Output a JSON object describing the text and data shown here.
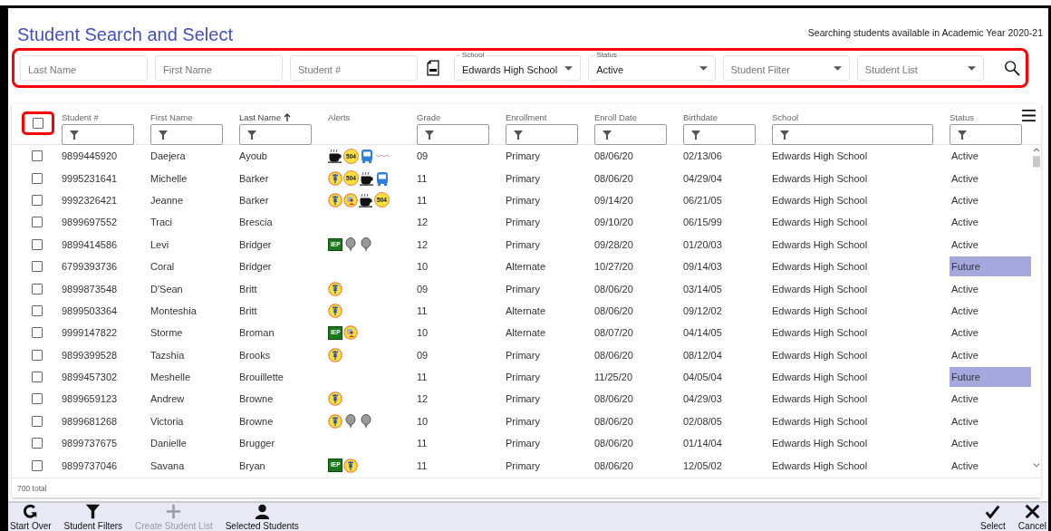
{
  "title": "Student Search and Select",
  "academic_year_note": "Searching students available in Academic Year 2020-21",
  "search_fields": [
    {
      "kind": "text",
      "placeholder": "Last Name"
    },
    {
      "kind": "text",
      "placeholder": "First Name"
    },
    {
      "kind": "text",
      "placeholder": "Student #"
    },
    {
      "kind": "csv"
    },
    {
      "kind": "select",
      "label": "School",
      "value": "Edwards High School"
    },
    {
      "kind": "select",
      "label": "Status",
      "value": "Active"
    },
    {
      "kind": "select",
      "placeholder": "Student Filter"
    },
    {
      "kind": "select",
      "placeholder": "Student List"
    },
    {
      "kind": "search"
    }
  ],
  "table": {
    "select_all": {
      "checked": false
    },
    "columns": [
      {
        "label": "Student #",
        "filter": true,
        "sorted": false
      },
      {
        "label": "First Name",
        "filter": true,
        "sorted": false
      },
      {
        "label": "Last Name",
        "filter": true,
        "sorted": true
      },
      {
        "label": "Alerts",
        "filter": false,
        "sorted": false
      },
      {
        "label": "Grade",
        "filter": true,
        "sorted": false
      },
      {
        "label": "Enrollment",
        "filter": true,
        "sorted": false
      },
      {
        "label": "Enroll Date",
        "filter": true,
        "sorted": false
      },
      {
        "label": "Birthdate",
        "filter": true,
        "sorted": false
      },
      {
        "label": "School",
        "filter": true,
        "sorted": false
      },
      {
        "label": "Status",
        "filter": true,
        "sorted": false
      }
    ],
    "rows": [
      {
        "checked": false,
        "student_no": "9899445920",
        "first_name": "Daejera",
        "last_name": "Ayoub",
        "alerts": [
          {
            "kind": "coffee"
          },
          {
            "kind": "round",
            "text": "504"
          },
          {
            "kind": "bus"
          },
          {
            "kind": "streamer"
          }
        ],
        "grade": "09",
        "enrollment": "Primary",
        "enroll_date": "08/06/20",
        "birthdate": "02/13/06",
        "school": "Edwards High School",
        "status": "Active",
        "highlighted": false
      },
      {
        "checked": false,
        "student_no": "9995231641",
        "first_name": "Michelle",
        "last_name": "Barker",
        "alerts": [
          {
            "kind": "medical"
          },
          {
            "kind": "round",
            "text": "504"
          },
          {
            "kind": "coffee"
          },
          {
            "kind": "bus"
          }
        ],
        "grade": "11",
        "enrollment": "Primary",
        "enroll_date": "08/06/20",
        "birthdate": "04/29/04",
        "school": "Edwards High School",
        "status": "Active",
        "highlighted": false
      },
      {
        "checked": false,
        "student_no": "9992326421",
        "first_name": "Jeanne",
        "last_name": "Barker",
        "alerts": [
          {
            "kind": "medical"
          },
          {
            "kind": "contact"
          },
          {
            "kind": "coffee"
          },
          {
            "kind": "round",
            "text": "504"
          }
        ],
        "grade": "11",
        "enrollment": "Primary",
        "enroll_date": "09/14/20",
        "birthdate": "06/21/05",
        "school": "Edwards High School",
        "status": "Active",
        "highlighted": false
      },
      {
        "checked": false,
        "student_no": "9899697552",
        "first_name": "Traci",
        "last_name": "Brescia",
        "grade": "12",
        "enrollment": "Primary",
        "enroll_date": "09/10/20",
        "birthdate": "06/15/99",
        "school": "Edwards High School",
        "status": "Active",
        "highlighted": false
      },
      {
        "checked": false,
        "student_no": "9899414586",
        "first_name": "Levi",
        "last_name": "Bridger",
        "alerts": [
          {
            "kind": "square",
            "text": "IEP"
          },
          {
            "kind": "pin"
          },
          {
            "kind": "pin"
          }
        ],
        "grade": "12",
        "enrollment": "Primary",
        "enroll_date": "09/28/20",
        "birthdate": "01/20/03",
        "school": "Edwards High School",
        "status": "Active",
        "highlighted": false
      },
      {
        "checked": false,
        "student_no": "6799393736",
        "first_name": "Coral",
        "last_name": "Bridger",
        "grade": "10",
        "enrollment": "Alternate",
        "enroll_date": "10/27/20",
        "birthdate": "09/14/03",
        "school": "Edwards High School",
        "status": "Future",
        "highlighted": true
      },
      {
        "checked": false,
        "student_no": "9899873548",
        "first_name": "D'Sean",
        "last_name": "Britt",
        "alerts": [
          {
            "kind": "medical"
          }
        ],
        "grade": "09",
        "enrollment": "Primary",
        "enroll_date": "08/06/20",
        "birthdate": "03/14/05",
        "school": "Edwards High School",
        "status": "Active",
        "highlighted": false
      },
      {
        "checked": false,
        "student_no": "9899503364",
        "first_name": "Monteshia",
        "last_name": "Britt",
        "alerts": [
          {
            "kind": "medical"
          }
        ],
        "grade": "11",
        "enrollment": "Alternate",
        "enroll_date": "08/06/20",
        "birthdate": "09/12/02",
        "school": "Edwards High School",
        "status": "Active",
        "highlighted": false
      },
      {
        "checked": false,
        "student_no": "9999147822",
        "first_name": "Storme",
        "last_name": "Broman",
        "alerts": [
          {
            "kind": "square",
            "text": "IEP"
          },
          {
            "kind": "contact"
          }
        ],
        "grade": "10",
        "enrollment": "Alternate",
        "enroll_date": "08/07/20",
        "birthdate": "04/14/05",
        "school": "Edwards High School",
        "status": "Active",
        "highlighted": false
      },
      {
        "checked": false,
        "student_no": "9899399528",
        "first_name": "Tazshia",
        "last_name": "Brooks",
        "alerts": [
          {
            "kind": "medical"
          }
        ],
        "grade": "09",
        "enrollment": "Primary",
        "enroll_date": "08/06/20",
        "birthdate": "08/12/04",
        "school": "Edwards High School",
        "status": "Active",
        "highlighted": false
      },
      {
        "checked": false,
        "student_no": "9899457302",
        "first_name": "Meshelle",
        "last_name": "Brouillette",
        "grade": "11",
        "enrollment": "Primary",
        "enroll_date": "11/25/20",
        "birthdate": "04/05/04",
        "school": "Edwards High School",
        "status": "Future",
        "highlighted": true
      },
      {
        "checked": false,
        "student_no": "9899659123",
        "first_name": "Andrew",
        "last_name": "Browne",
        "alerts": [
          {
            "kind": "medical"
          }
        ],
        "grade": "12",
        "enrollment": "Primary",
        "enroll_date": "08/06/20",
        "birthdate": "04/29/03",
        "school": "Edwards High School",
        "status": "Active",
        "highlighted": false
      },
      {
        "checked": false,
        "student_no": "9899681268",
        "first_name": "Victoria",
        "last_name": "Browne",
        "alerts": [
          {
            "kind": "medical"
          },
          {
            "kind": "pin"
          },
          {
            "kind": "pin"
          }
        ],
        "grade": "10",
        "enrollment": "Primary",
        "enroll_date": "08/06/20",
        "birthdate": "02/08/05",
        "school": "Edwards High School",
        "status": "Active",
        "highlighted": false
      },
      {
        "checked": false,
        "student_no": "9899737675",
        "first_name": "Danielle",
        "last_name": "Brugger",
        "grade": "11",
        "enrollment": "Primary",
        "enroll_date": "08/06/20",
        "birthdate": "01/14/04",
        "school": "Edwards High School",
        "status": "Active",
        "highlighted": false
      },
      {
        "checked": false,
        "student_no": "9899737046",
        "first_name": "Savana",
        "last_name": "Bryan",
        "alerts": [
          {
            "kind": "square",
            "text": "IEP"
          },
          {
            "kind": "medical"
          }
        ],
        "grade": "11",
        "enrollment": "Primary",
        "enroll_date": "08/06/20",
        "birthdate": "12/05/02",
        "school": "Edwards High School",
        "status": "Active",
        "highlighted": false
      }
    ],
    "total": "700 total"
  },
  "toolbar_left": [
    {
      "label": "Start Over",
      "disabled": false
    },
    {
      "label": "Student Filters",
      "disabled": false
    },
    {
      "label": "Create Student List",
      "disabled": true
    },
    {
      "label": "Selected Students",
      "disabled": false
    }
  ],
  "toolbar_right": [
    {
      "label": "Select",
      "disabled": false
    },
    {
      "label": "Cancel",
      "disabled": false
    }
  ]
}
